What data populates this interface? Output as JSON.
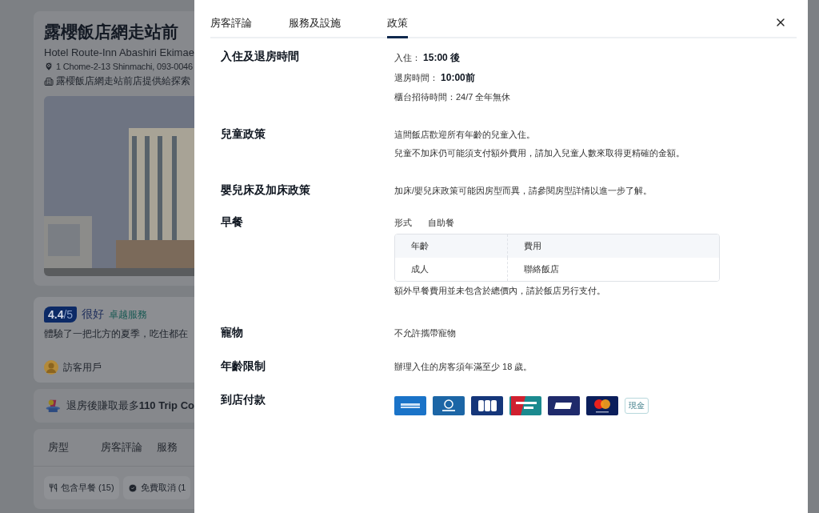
{
  "background": {
    "hotel_name": "露櫻飯店網走站前",
    "english_name": "Hotel Route-Inn Abashiri Ekimae",
    "address": "1 Chome-2-13 Shinmachi, 093-0046",
    "description": "露櫻飯店網走站前店提供給探索",
    "review": {
      "score": "4.4",
      "out_of": "/5",
      "rating": "很好",
      "badge": "卓越服務",
      "text": "體驗了一把北方的夏季，吃住都在",
      "author": "訪客用戶"
    },
    "coins": {
      "text": "退房後賺取最多**110 Trip Co**"
    },
    "tabs": [
      {
        "label": "房型",
        "selected": false
      },
      {
        "label": "房客評論",
        "selected": false
      },
      {
        "label": "服務",
        "selected": false
      }
    ],
    "filters": [
      {
        "kind": "meal",
        "label": "包含早餐 (15)"
      },
      {
        "kind": "check",
        "label": "免費取消 (1"
      }
    ]
  },
  "modal": {
    "tabs": [
      {
        "label": "房客評論",
        "selected": false
      },
      {
        "label": "服務及設施",
        "selected": false
      },
      {
        "label": "政策",
        "selected": true
      }
    ],
    "sections": [
      {
        "kind": "lines",
        "title": "入住及退房時間",
        "lines": [
          "入住：  **15:00 後**",
          "退房時間：  **10:00前**",
          "櫃台招待時間：24/7 全年無休"
        ]
      },
      {
        "kind": "lines",
        "title": "兒童政策",
        "lines": [
          "這間飯店歡迎所有年齡的兒童入住。",
          "兒童不加床仍可能須支付額外費用，請加入兒童人數來取得更精確的金額。"
        ]
      },
      {
        "kind": "lines",
        "title": "嬰兒床及加床政策",
        "lines": [
          "加床/嬰兒床政策可能因房型而異，請參閱房型詳情以進一步了解。"
        ]
      },
      {
        "kind": "breakfast",
        "title": "早餐",
        "type_label": "形式",
        "type_value": "自助餐",
        "columns": [
          "年齡",
          "費用"
        ],
        "rows": [
          [
            "成人",
            "聯絡飯店"
          ]
        ],
        "note": "額外早餐費用並未包含於總價內，請於飯店另行支付。"
      },
      {
        "kind": "lines",
        "title": "寵物",
        "lines": [
          "不允許攜帶寵物"
        ]
      },
      {
        "kind": "lines",
        "title": "年齡限制",
        "lines": [
          "辦理入住的房客須年滿至少 18 歲。"
        ]
      },
      {
        "kind": "payment",
        "title": "到店付款",
        "cards": [
          {
            "kind": "amex"
          },
          {
            "kind": "diners"
          },
          {
            "kind": "jcb"
          },
          {
            "kind": "unionpay"
          },
          {
            "kind": "visa"
          },
          {
            "kind": "mastercard"
          }
        ],
        "cash": "現金"
      }
    ]
  }
}
